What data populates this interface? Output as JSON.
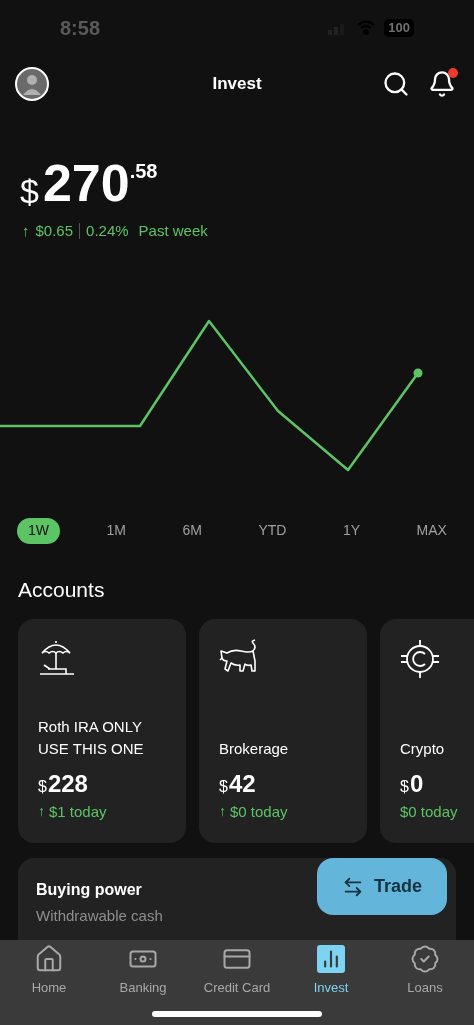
{
  "status_bar": {
    "time": "8:58",
    "battery": "100"
  },
  "header": {
    "title": "Invest",
    "notification_dot": true
  },
  "balance": {
    "currency": "$",
    "whole": "270",
    "cents": ".58"
  },
  "change": {
    "arrow": "↑",
    "amount": "$0.65",
    "percent": "0.24%",
    "period": "Past week"
  },
  "ranges": [
    {
      "label": "1W",
      "selected": true
    },
    {
      "label": "1M",
      "selected": false
    },
    {
      "label": "6M",
      "selected": false
    },
    {
      "label": "YTD",
      "selected": false
    },
    {
      "label": "1Y",
      "selected": false
    },
    {
      "label": "MAX",
      "selected": false
    }
  ],
  "accounts": {
    "title": "Accounts",
    "items": [
      {
        "kind": "umbrella",
        "name": "Roth IRA ONLY USE THIS ONE",
        "currency": "$",
        "amount": "228",
        "arrow": "↑",
        "change": "$1 today"
      },
      {
        "kind": "bull",
        "name": "Brokerage",
        "currency": "$",
        "amount": "42",
        "arrow": "↑",
        "change": "$0 today"
      },
      {
        "kind": "coin",
        "name": "Crypto",
        "currency": "$",
        "amount": "0",
        "change": "$0 today"
      }
    ]
  },
  "buying_power": {
    "title": "Buying power",
    "subtitle": "Withdrawable cash"
  },
  "trade_button": {
    "label": "Trade"
  },
  "nav": [
    {
      "kind": "home",
      "label": "Home",
      "selected": false
    },
    {
      "kind": "banking",
      "label": "Banking",
      "selected": false
    },
    {
      "kind": "card",
      "label": "Credit Card",
      "selected": false
    },
    {
      "kind": "invest",
      "label": "Invest",
      "selected": true
    },
    {
      "kind": "loans",
      "label": "Loans",
      "selected": false
    }
  ]
}
